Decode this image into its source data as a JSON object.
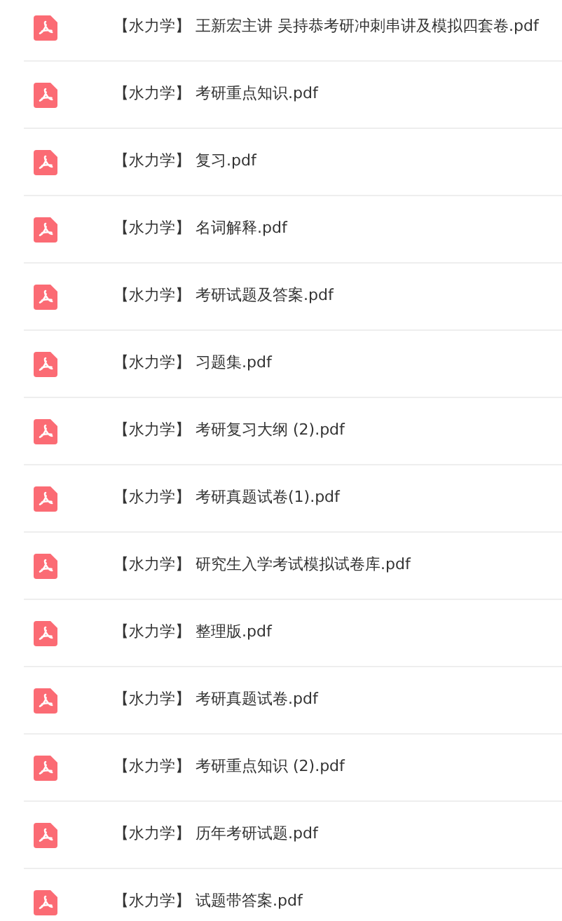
{
  "files": [
    {
      "name": "【水力学】 王新宏主讲 吴持恭考研冲刺串讲及模拟四套卷.pdf"
    },
    {
      "name": "【水力学】 考研重点知识.pdf"
    },
    {
      "name": "【水力学】 复习.pdf"
    },
    {
      "name": "【水力学】 名词解释.pdf"
    },
    {
      "name": "【水力学】 考研试题及答案.pdf"
    },
    {
      "name": "【水力学】 习题集.pdf"
    },
    {
      "name": "【水力学】 考研复习大纲 (2).pdf"
    },
    {
      "name": "【水力学】 考研真题试卷(1).pdf"
    },
    {
      "name": "【水力学】 研究生入学考试模拟试卷库.pdf"
    },
    {
      "name": "【水力学】 整理版.pdf"
    },
    {
      "name": "【水力学】 考研真题试卷.pdf"
    },
    {
      "name": "【水力学】 考研重点知识 (2).pdf"
    },
    {
      "name": "【水力学】 历年考研试题.pdf"
    },
    {
      "name": "【水力学】 试题带答案.pdf"
    }
  ]
}
